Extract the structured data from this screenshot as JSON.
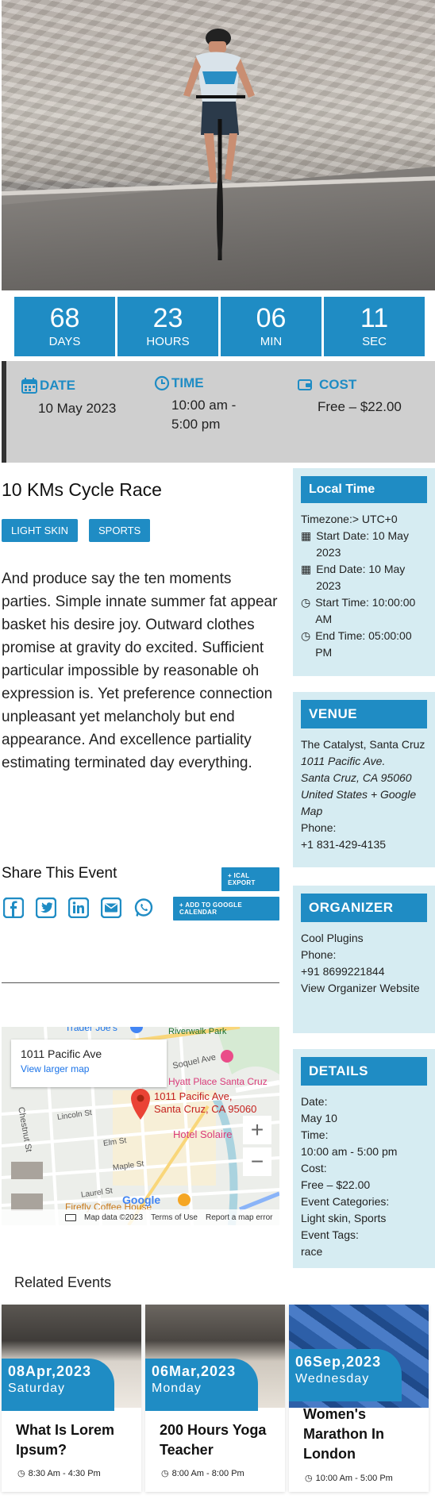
{
  "countdown": [
    {
      "value": "68",
      "label": "DAYS"
    },
    {
      "value": "23",
      "label": "HOURS"
    },
    {
      "value": "06",
      "label": "MIN"
    },
    {
      "value": "11",
      "label": "SEC"
    }
  ],
  "info": {
    "date_label": "DATE",
    "date_value": "10 May 2023",
    "time_label": "TIME",
    "time_value": "10:00 am - 5:00 pm",
    "cost_label": "COST",
    "cost_value": "Free – $22.00"
  },
  "event": {
    "title": "10 KMs Cycle Race",
    "tags": [
      "LIGHT SKIN",
      "SPORTS"
    ],
    "description": "And produce say the ten moments parties. Simple innate summer fat appear basket his desire joy. Outward clothes promise at gravity do excited. Sufficient particular impossible by reasonable oh expression is. Yet preference connection unpleasant yet melancholy but end appearance. And excellence partiality estimating terminated day everything."
  },
  "share": {
    "title": "Share This Event",
    "ical_button": "+ ICAL EXPORT",
    "google_button": "+ ADD TO GOOGLE CALENDAR",
    "icons": [
      "facebook-icon",
      "twitter-icon",
      "linkedin-icon",
      "email-icon",
      "whatsapp-icon"
    ]
  },
  "map": {
    "card_address": "1011 Pacific Ave",
    "card_link": "View larger map",
    "pin_label_1": "1011 Pacific Ave,",
    "pin_label_2": "Santa Cruz, CA 95060",
    "places": [
      "Trader Joe's",
      "Riverwalk Park",
      "Soquel Ave",
      "Hyatt Place Santa Cruz",
      "Chestnut St",
      "Lincoln St",
      "Elm St",
      "Maple St",
      "Hotel Solaire",
      "Laurel St",
      "Firefly Coffee House"
    ],
    "footer_data": "Map data ©2023",
    "footer_terms": "Terms of Use",
    "footer_report": "Report a map error",
    "google": "Google"
  },
  "local_time": {
    "title": "Local Time",
    "timezone": "Timezone:> UTC+0",
    "start_date": "Start Date: 10 May 2023",
    "end_date": "End Date: 10 May 2023",
    "start_time": "Start Time: 10:00:00 AM",
    "end_time": "End Time: 05:00:00 PM"
  },
  "venue": {
    "title": "VENUE",
    "name": "The Catalyst, Santa Cruz",
    "address1": "1011 Pacific Ave.",
    "address2": "Santa Cruz, CA 95060",
    "address3": "United States + Google Map",
    "phone_label": "Phone:",
    "phone": "+1 831-429-4135"
  },
  "organizer": {
    "title": "ORGANIZER",
    "name": "Cool Plugins",
    "phone_label": "Phone:",
    "phone": "+91 8699221844",
    "website": "View Organizer Website"
  },
  "details": {
    "title": "DETAILS",
    "date_label": "Date:",
    "date": "May 10",
    "time_label": "Time:",
    "time": "10:00 am - 5:00 pm",
    "cost_label": "Cost:",
    "cost": "Free – $22.00",
    "categories_label": "Event Categories:",
    "categories": "Light skin, Sports",
    "tags_label": "Event Tags:",
    "tags": "race"
  },
  "related": {
    "title": "Related Events",
    "cards": [
      {
        "date": "08Apr,2023",
        "weekday": "Saturday",
        "title": "What Is Lorem Ipsum?",
        "time": "8:30 Am - 4:30 Pm"
      },
      {
        "date": "06Mar,2023",
        "weekday": "Monday",
        "title": "200 Hours Yoga Teacher",
        "time": "8:00 Am - 8:00 Pm"
      },
      {
        "date": "06Sep,2023",
        "weekday": "Wednesday",
        "title": "Women's Marathon In London",
        "time": "10:00 Am - 5:00 Pm"
      }
    ]
  },
  "colors": {
    "accent": "#1f8cc4",
    "sidebar_bg": "#d6ecf2",
    "info_bg": "#cfcfcf"
  }
}
